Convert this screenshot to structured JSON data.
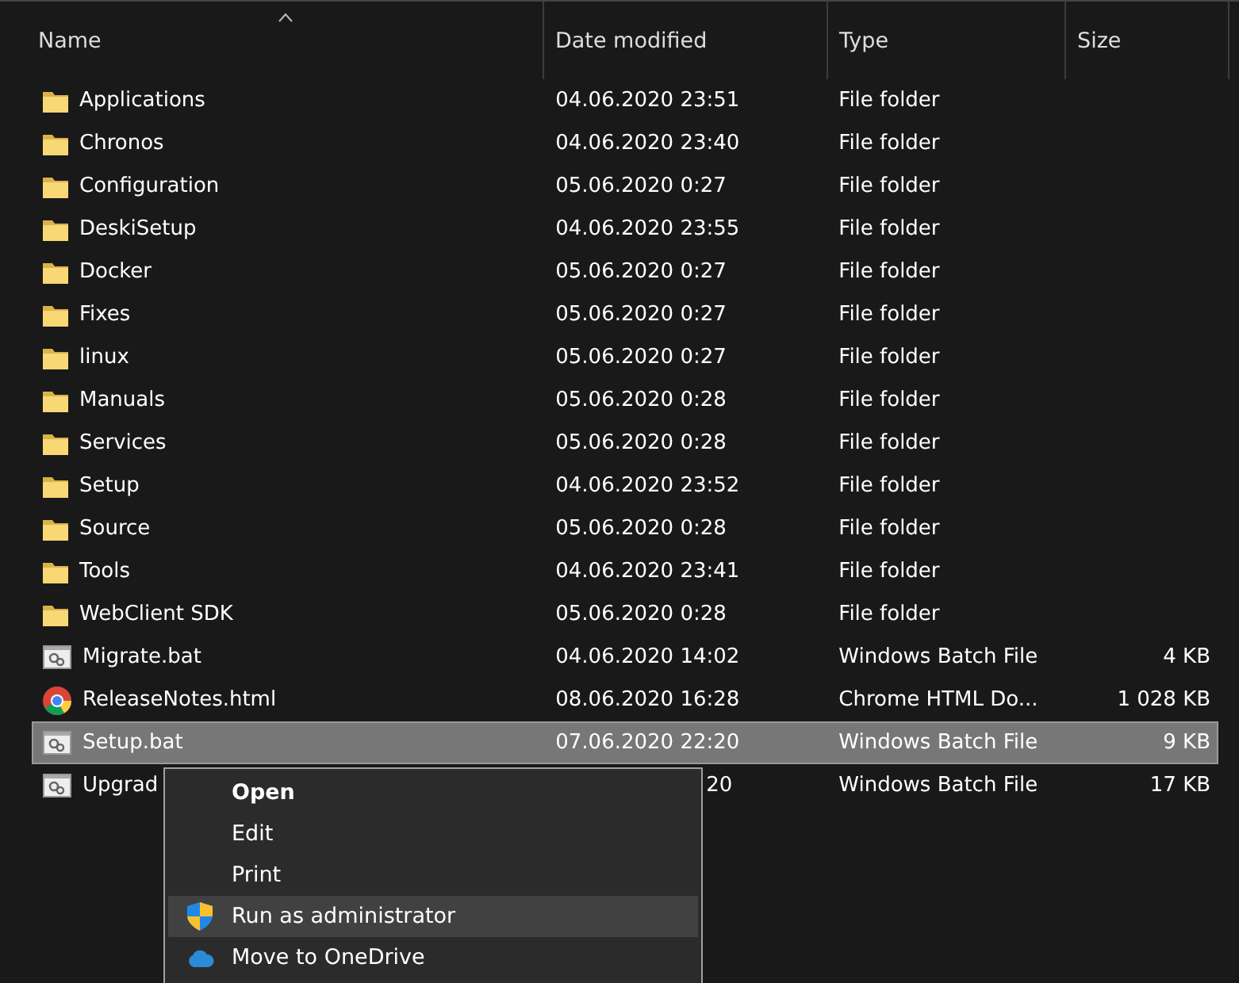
{
  "columns": [
    {
      "label": "Name",
      "sorted": true
    },
    {
      "label": "Date modified",
      "sorted": false
    },
    {
      "label": "Type",
      "sorted": false
    },
    {
      "label": "Size",
      "sorted": false
    }
  ],
  "rows": [
    {
      "kind": "folder",
      "name": "Applications",
      "date": "04.06.2020 23:51",
      "type": "File folder",
      "selected": false
    },
    {
      "kind": "folder",
      "name": "Chronos",
      "date": "04.06.2020 23:40",
      "type": "File folder",
      "selected": false
    },
    {
      "kind": "folder",
      "name": "Configuration",
      "date": "05.06.2020 0:27",
      "type": "File folder",
      "selected": false
    },
    {
      "kind": "folder",
      "name": "DeskiSetup",
      "date": "04.06.2020 23:55",
      "type": "File folder",
      "selected": false
    },
    {
      "kind": "folder",
      "name": "Docker",
      "date": "05.06.2020 0:27",
      "type": "File folder",
      "selected": false
    },
    {
      "kind": "folder",
      "name": "Fixes",
      "date": "05.06.2020 0:27",
      "type": "File folder",
      "selected": false
    },
    {
      "kind": "folder",
      "name": "linux",
      "date": "05.06.2020 0:27",
      "type": "File folder",
      "selected": false
    },
    {
      "kind": "folder",
      "name": "Manuals",
      "date": "05.06.2020 0:28",
      "type": "File folder",
      "selected": false
    },
    {
      "kind": "folder",
      "name": "Services",
      "date": "05.06.2020 0:28",
      "type": "File folder",
      "selected": false
    },
    {
      "kind": "folder",
      "name": "Setup",
      "date": "04.06.2020 23:52",
      "type": "File folder",
      "selected": false
    },
    {
      "kind": "folder",
      "name": "Source",
      "date": "05.06.2020 0:28",
      "type": "File folder",
      "selected": false
    },
    {
      "kind": "folder",
      "name": "Tools",
      "date": "04.06.2020 23:41",
      "type": "File folder",
      "selected": false
    },
    {
      "kind": "folder",
      "name": "WebClient SDK",
      "date": "05.06.2020 0:28",
      "type": "File folder",
      "selected": false
    },
    {
      "kind": "batch",
      "name": "Migrate.bat",
      "date": "04.06.2020 14:02",
      "type": "Windows Batch File",
      "size": "4 KB",
      "selected": false
    },
    {
      "kind": "html",
      "name": "ReleaseNotes.html",
      "date": "08.06.2020 16:28",
      "type": "Chrome HTML Do...",
      "size": "1 028 KB",
      "selected": false
    },
    {
      "kind": "batch",
      "name": "Setup.bat",
      "date": "07.06.2020 22:20",
      "type": "Windows Batch File",
      "size": "9 KB",
      "selected": true
    },
    {
      "kind": "batch",
      "name": "Upgrad",
      "date": "20",
      "type": "Windows Batch File",
      "size": "17 KB",
      "selected": false,
      "covered": true
    }
  ],
  "context_menu": {
    "items": [
      {
        "label": "Open",
        "default": true,
        "highlighted": false
      },
      {
        "label": "Edit",
        "default": false,
        "highlighted": false
      },
      {
        "label": "Print",
        "default": false,
        "highlighted": false
      },
      {
        "label": "Run as administrator",
        "kind": "shield",
        "default": false,
        "highlighted": true
      },
      {
        "label": "Move to OneDrive",
        "kind": "cloud",
        "default": false,
        "highlighted": false
      }
    ]
  }
}
